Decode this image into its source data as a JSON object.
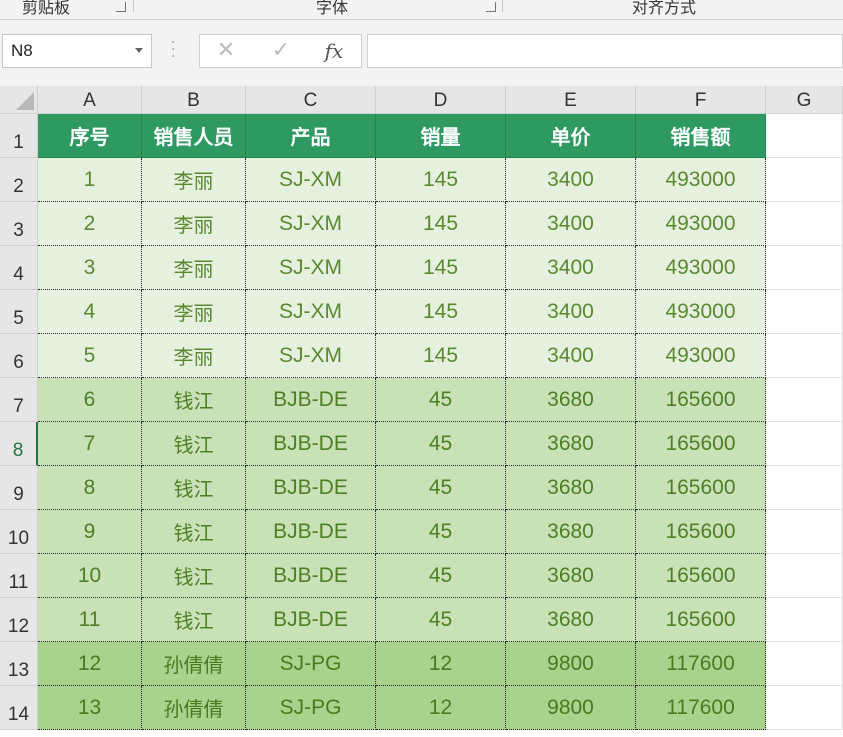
{
  "ribbon": {
    "groups": [
      {
        "label": "剪贴板",
        "launcher": "⌟"
      },
      {
        "label": "字体",
        "launcher": "⌟"
      },
      {
        "label": "对齐方式",
        "launcher": ""
      }
    ]
  },
  "formula_bar": {
    "name_box": "N8",
    "cancel_icon": "✕",
    "enter_icon": "✓",
    "fx_label": "fx",
    "formula_value": ""
  },
  "sheet": {
    "columns": [
      "A",
      "B",
      "C",
      "D",
      "E",
      "F",
      "G"
    ],
    "rows": [
      "1",
      "2",
      "3",
      "4",
      "5",
      "6",
      "7",
      "8",
      "9",
      "10",
      "11",
      "12",
      "13",
      "14"
    ],
    "selected_row": "8",
    "header": [
      "序号",
      "销售人员",
      "产品",
      "销量",
      "单价",
      "销售额"
    ],
    "data": [
      [
        "1",
        "李丽",
        "SJ-XM",
        "145",
        "3400",
        "493000"
      ],
      [
        "2",
        "李丽",
        "SJ-XM",
        "145",
        "3400",
        "493000"
      ],
      [
        "3",
        "李丽",
        "SJ-XM",
        "145",
        "3400",
        "493000"
      ],
      [
        "4",
        "李丽",
        "SJ-XM",
        "145",
        "3400",
        "493000"
      ],
      [
        "5",
        "李丽",
        "SJ-XM",
        "145",
        "3400",
        "493000"
      ],
      [
        "6",
        "钱江",
        "BJB-DE",
        "45",
        "3680",
        "165600"
      ],
      [
        "7",
        "钱江",
        "BJB-DE",
        "45",
        "3680",
        "165600"
      ],
      [
        "8",
        "钱江",
        "BJB-DE",
        "45",
        "3680",
        "165600"
      ],
      [
        "9",
        "钱江",
        "BJB-DE",
        "45",
        "3680",
        "165600"
      ],
      [
        "10",
        "钱江",
        "BJB-DE",
        "45",
        "3680",
        "165600"
      ],
      [
        "11",
        "钱江",
        "BJB-DE",
        "45",
        "3680",
        "165600"
      ],
      [
        "12",
        "孙倩倩",
        "SJ-PG",
        "12",
        "9800",
        "117600"
      ],
      [
        "13",
        "孙倩倩",
        "SJ-PG",
        "12",
        "9800",
        "117600"
      ]
    ],
    "colors": {
      "header_fill": "#2e9a62",
      "group1_fill": "#e5f0df",
      "group2_fill": "#c8e1b7",
      "group3_fill": "#a9d28d",
      "text_green": "#5b8a2e"
    }
  }
}
